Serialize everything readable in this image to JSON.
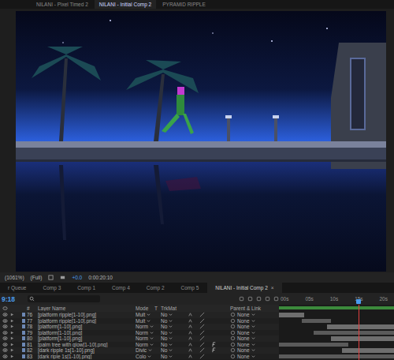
{
  "doc_tabs": [
    {
      "label": "NILANI - Pixel Timed 2",
      "selected": false
    },
    {
      "label": "NILANI - Initial Comp 2",
      "selected": true
    },
    {
      "label": "PYRAMID RIPPLE",
      "selected": false
    }
  ],
  "viewer_toolbar": {
    "zoom": "(1061%)",
    "resolution": "(Full)",
    "exposure": "+0.0",
    "timecode": "0:00:20:10"
  },
  "panel_tabs": [
    {
      "label": "r Queue",
      "selected": false
    },
    {
      "label": "Comp 3",
      "selected": false
    },
    {
      "label": "Comp 1",
      "selected": false
    },
    {
      "label": "Comp 4",
      "selected": false
    },
    {
      "label": "Comp 2",
      "selected": false
    },
    {
      "label": "Comp 5",
      "selected": false
    },
    {
      "label": "NILANI - Initial Comp 2",
      "selected": true
    }
  ],
  "close_glyph": "×",
  "current_time": "9:18",
  "ruler": [
    "00s",
    "05s",
    "10s",
    "15s",
    "20s"
  ],
  "playhead": 0.69,
  "work_area": {
    "in": 0.0,
    "out": 1.0
  },
  "columns": {
    "number": "#",
    "name": "Layer Name",
    "mode": "Mode",
    "t": "T",
    "trkmat": "TrkMat",
    "parent": "Parent & Link"
  },
  "layers": [
    {
      "number": "76",
      "name": "[platform ripple[1-10].png]",
      "mode": "Mult",
      "trkmat": "No",
      "fx": false,
      "parent": "None",
      "visible": true,
      "in": 0.0,
      "out": 0.22
    },
    {
      "number": "77",
      "name": "[platform ripple[1-10].png]",
      "mode": "Mult",
      "trkmat": "No",
      "fx": false,
      "parent": "None",
      "visible": true,
      "in": 0.2,
      "out": 0.45
    },
    {
      "number": "78",
      "name": "[platform[1-10].png]",
      "mode": "Norm",
      "trkmat": "No",
      "fx": false,
      "parent": "None",
      "visible": true,
      "in": 0.42,
      "out": 1.0
    },
    {
      "number": "79",
      "name": "[platform[1-10].png]",
      "mode": "Norm",
      "trkmat": "No",
      "fx": false,
      "parent": "None",
      "visible": true,
      "in": 0.3,
      "out": 1.0
    },
    {
      "number": "80",
      "name": "[platform[1-10].png]",
      "mode": "Norm",
      "trkmat": "No",
      "fx": false,
      "parent": "None",
      "visible": true,
      "in": 0.45,
      "out": 1.0
    },
    {
      "number": "81",
      "name": "[palm tree with glow[1-10].png]",
      "mode": "Norm",
      "trkmat": "No",
      "fx": true,
      "parent": "None",
      "visible": true,
      "in": 0.0,
      "out": 0.6
    },
    {
      "number": "82",
      "name": "[dark ripple 1s[1-10].png]",
      "mode": "Divic",
      "trkmat": "No",
      "fx": true,
      "parent": "None",
      "visible": true,
      "in": 0.55,
      "out": 1.0
    },
    {
      "number": "83",
      "name": "[dark riple 1s[1-10].png]",
      "mode": "Colo",
      "trkmat": "No",
      "fx": false,
      "parent": "None",
      "visible": true,
      "in": 0.0,
      "out": 1.0
    }
  ]
}
